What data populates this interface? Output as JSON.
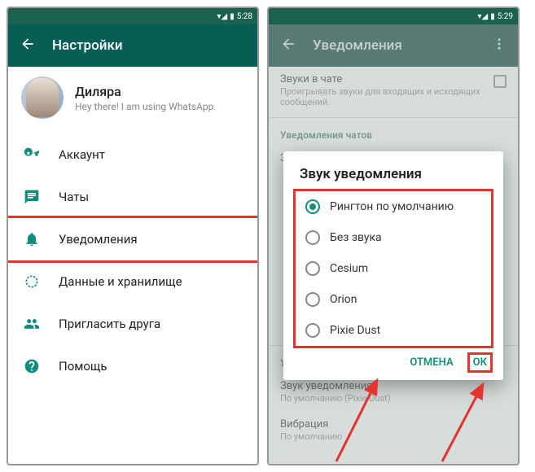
{
  "leftPhone": {
    "statusTime": "5:28",
    "appBarTitle": "Настройки",
    "profile": {
      "name": "Диляра",
      "status": "Hey there! I am using WhatsApp."
    },
    "items": [
      {
        "icon": "key",
        "label": "Аккаунт"
      },
      {
        "icon": "chat",
        "label": "Чаты"
      },
      {
        "icon": "bell",
        "label": "Уведомления"
      },
      {
        "icon": "data",
        "label": "Данные и хранилище"
      },
      {
        "icon": "invite",
        "label": "Пригласить друга"
      },
      {
        "icon": "help",
        "label": "Помощь"
      }
    ]
  },
  "rightPhone": {
    "statusTime": "5:29",
    "appBarTitle": "Уведомления",
    "topSetting": {
      "title": "Звуки в чате",
      "sub": "Проигрывать звуки для входящих и исходящих сообщений."
    },
    "section1": "Уведомления чатов",
    "soundSetting": {
      "title": "Звук уведомления"
    },
    "modal": {
      "title": "Звук уведомления",
      "options": [
        "Рингтон по умолчанию",
        "Без звука",
        "Cesium",
        "Orion",
        "Pixie Dust"
      ],
      "selectedIndex": 0,
      "cancel": "ОТМЕНА",
      "ok": "ОК"
    },
    "section2": "Уведомления групп",
    "groupSound": {
      "title": "Звук уведомления",
      "sub": "По умолчанию (Pixie Dust)"
    },
    "vibration": {
      "title": "Вибрация",
      "sub": "По умолчанию"
    }
  }
}
